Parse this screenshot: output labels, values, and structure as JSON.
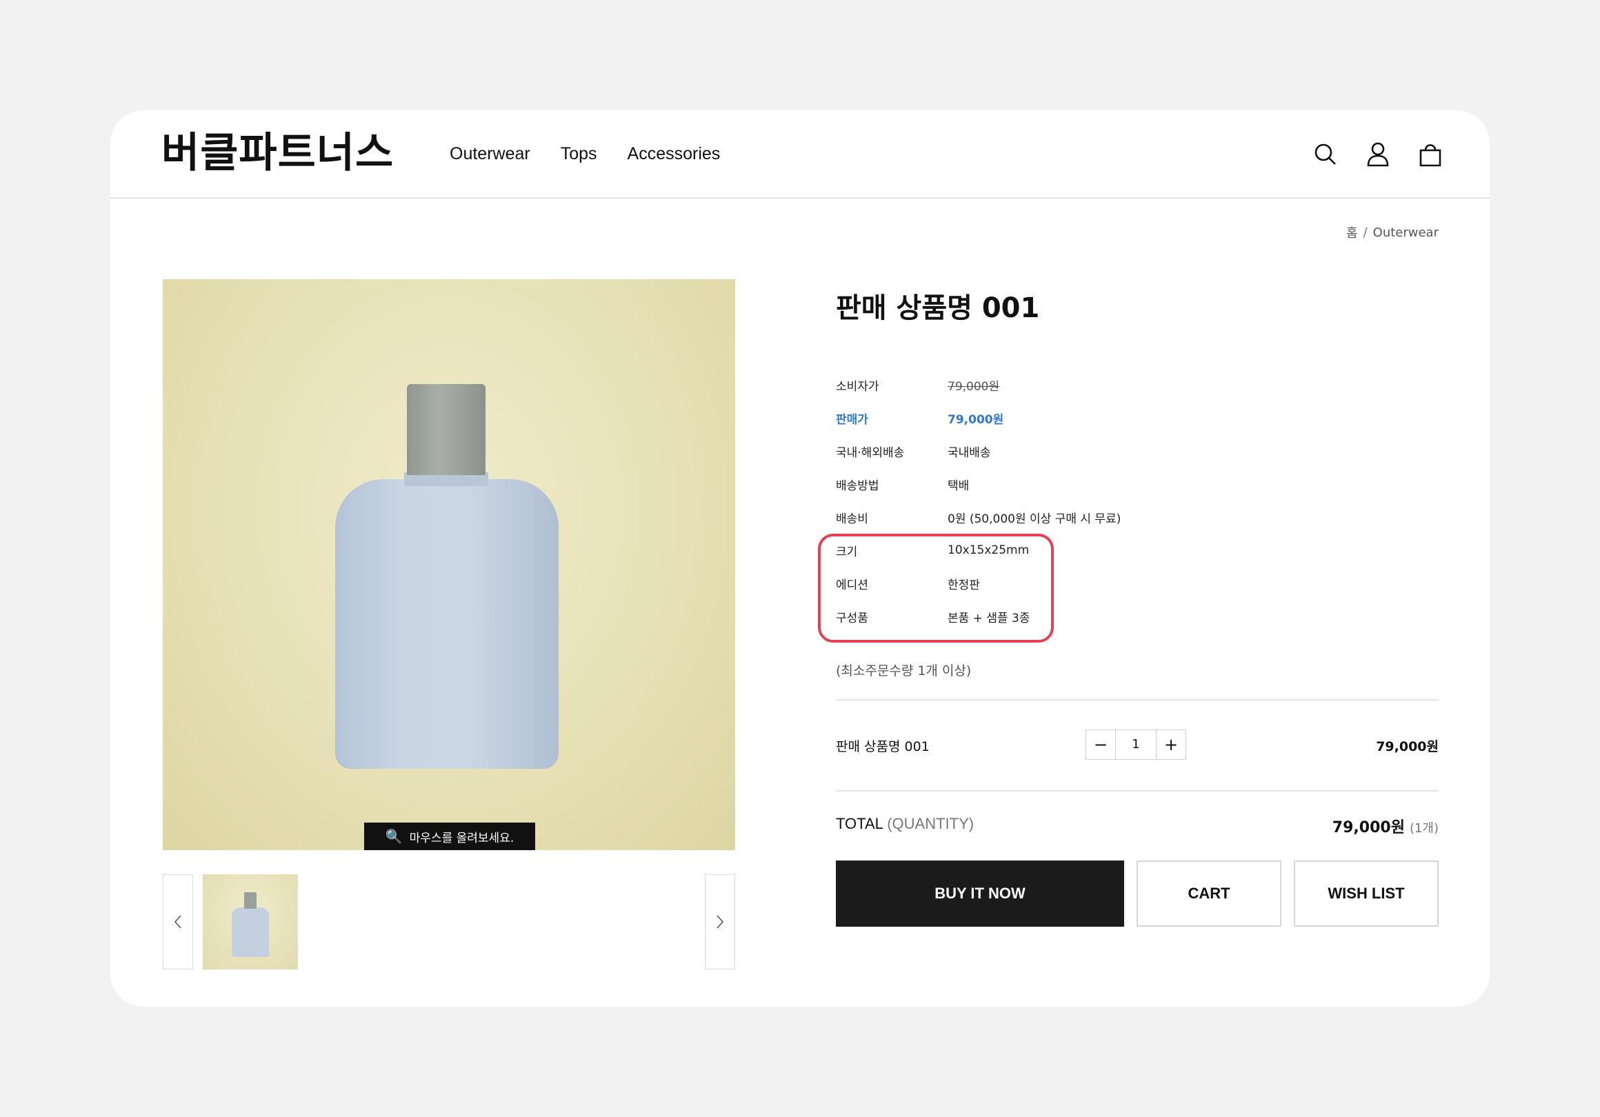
{
  "header": {
    "logo": "버클파트너스",
    "nav": [
      "Outerwear",
      "Tops",
      "Accessories"
    ],
    "icons": [
      "search-icon",
      "user-icon",
      "shopping-bag-icon"
    ]
  },
  "breadcrumb": {
    "home": "홈",
    "separator": "/",
    "current": "Outerwear"
  },
  "gallery": {
    "zoom_hint": "마우스를 올려보세요."
  },
  "product": {
    "title": "판매 상품명 001",
    "specs": [
      {
        "label": "소비자가",
        "value": "79,000원"
      },
      {
        "label": "판매가",
        "value": "79,000원"
      },
      {
        "label": "국내·해외배송",
        "value": "국내배송"
      },
      {
        "label": "배송방법",
        "value": "택배"
      },
      {
        "label": "배송비",
        "value": "0원 (50,000원 이상 구매 시 무료)"
      },
      {
        "label": "크기",
        "value": "10x15x25mm"
      },
      {
        "label": "에디션",
        "value": "한정판"
      },
      {
        "label": "구성품",
        "value": "본품 + 샘플 3종"
      }
    ],
    "min_order": "(최소주문수량 1개 이상)",
    "line_item": {
      "name": "판매 상품명 001",
      "quantity": "1",
      "minus": "−",
      "plus": "+",
      "price": "79,000원"
    },
    "total": {
      "label": "TOTAL",
      "qty_label": "(QUANTITY)",
      "amount": "79,000원",
      "count": "(1개)"
    },
    "actions": {
      "buy": "BUY IT NOW",
      "cart": "CART",
      "wishlist": "WISH LIST"
    }
  },
  "colors": {
    "sale_price": "#2e7ad1",
    "highlight": "#e64055",
    "buy_button": "#1b1b1b"
  }
}
